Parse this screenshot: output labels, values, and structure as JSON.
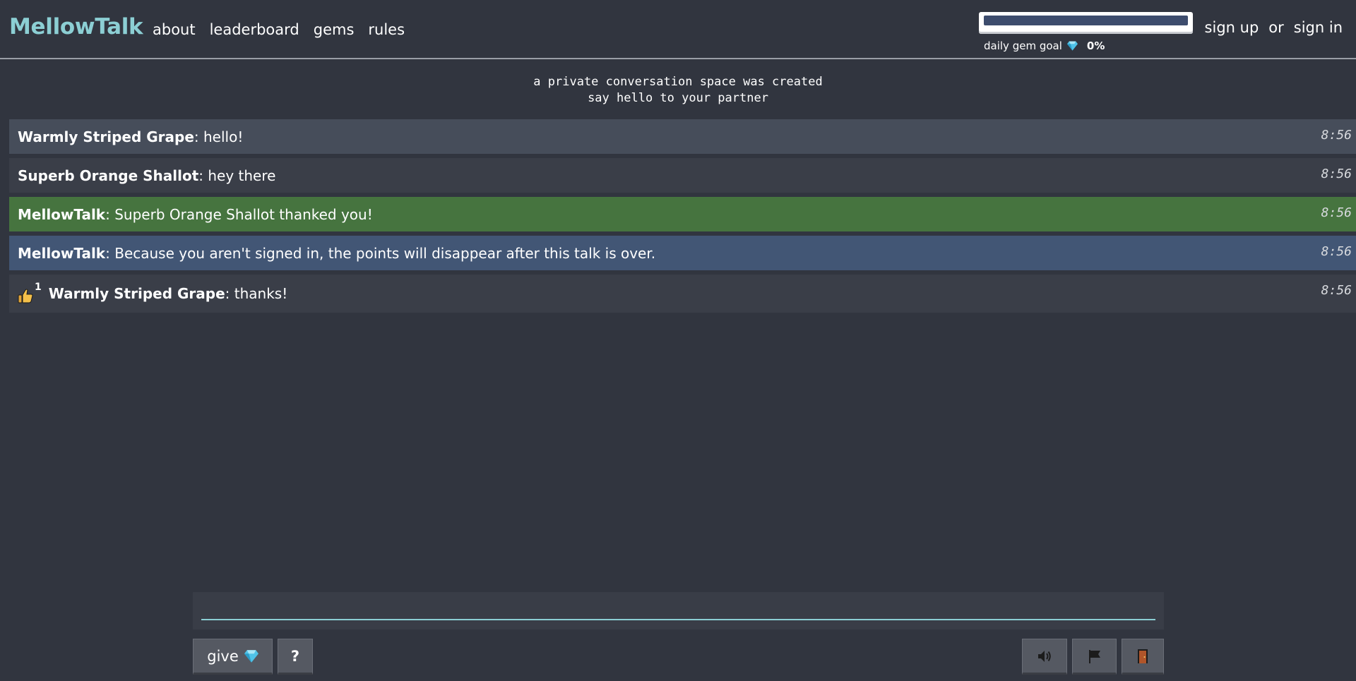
{
  "header": {
    "logo": "MellowTalk",
    "nav": [
      "about",
      "leaderboard",
      "gems",
      "rules"
    ],
    "daily_goal_label": "daily gem goal",
    "daily_goal_percent": "0%",
    "daily_goal_progress": 0,
    "sign_up": "sign up",
    "or": "or",
    "sign_in": "sign in"
  },
  "notice": {
    "line1": "a private conversation space was created",
    "line2": "say hello to your partner"
  },
  "messages": [
    {
      "name": "Warmly Striped Grape",
      "text": ": hello!",
      "time": "8:56",
      "style": "light"
    },
    {
      "name": "Superb Orange Shallot",
      "text": ": hey there",
      "time": "8:56",
      "style": "dark"
    },
    {
      "name": "MellowTalk",
      "text": ": Superb Orange Shallot thanked you!",
      "time": "8:56",
      "style": "green"
    },
    {
      "name": "MellowTalk",
      "text": ": Because you aren't signed in, the points will disappear after this talk is over.",
      "time": "8:56",
      "style": "blue"
    },
    {
      "name": "Warmly Striped Grape",
      "text": ": thanks!",
      "time": "8:56",
      "style": "dark",
      "thumbs_count": "1"
    }
  ],
  "composer": {
    "value": "",
    "give_label": "give",
    "help_label": "?"
  },
  "icons": {
    "gem": "gem-icon",
    "thumbs_up": "thumbs-up-icon",
    "sound": "speaker-icon",
    "flag": "flag-icon",
    "exit": "door-icon"
  },
  "colors": {
    "background": "#31353f",
    "brand": "#8ccfd4",
    "green_row": "#46743f",
    "blue_row": "#425675"
  }
}
